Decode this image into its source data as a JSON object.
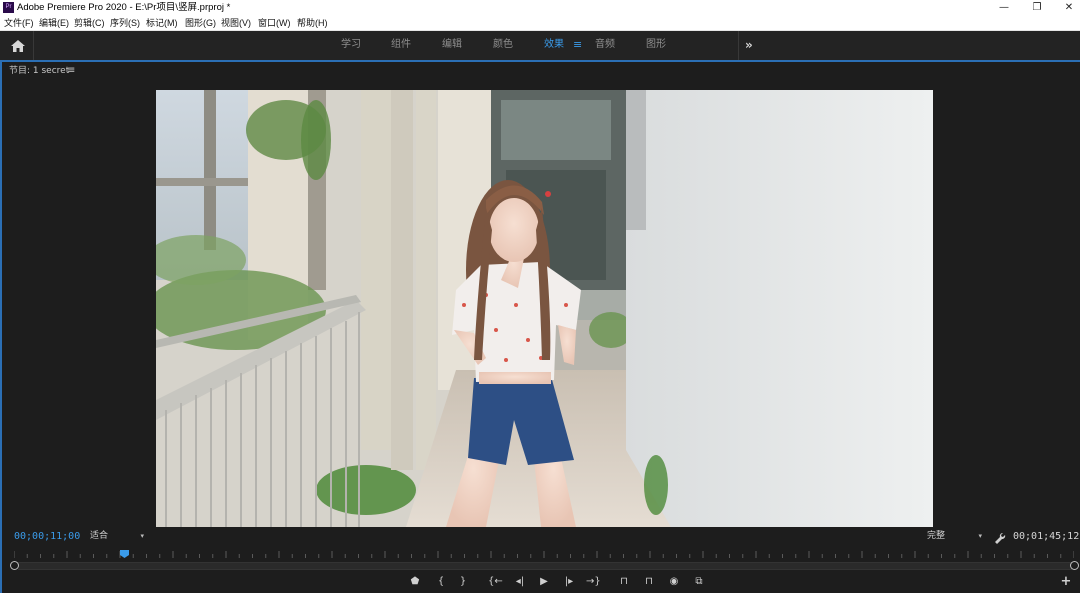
{
  "window": {
    "app_icon_text": "Pr",
    "title": "Adobe Premiere Pro 2020 - E:\\Pr项目\\竖屏.prproj *",
    "controls": [
      "—",
      "❐",
      "✕"
    ]
  },
  "menu": [
    "文件(F)",
    "编辑(E)",
    "剪辑(C)",
    "序列(S)",
    "标记(M)",
    "图形(G)",
    "视图(V)",
    "窗口(W)",
    "帮助(H)"
  ],
  "workspace": {
    "tabs": [
      "学习",
      "组件",
      "编辑",
      "颜色",
      "效果",
      "音频",
      "图形"
    ],
    "active_tab": "效果",
    "active_menu_icon": "≡",
    "more_icon": "»"
  },
  "panel": {
    "title": "节目: 1 secret",
    "menu_icon": "≡"
  },
  "monitor": {
    "current_timecode": "00;00;11;00",
    "zoom_label": "适合",
    "resolution_label": "完整",
    "duration_timecode": "00;01;45;12",
    "playhead_fraction": 0.104
  },
  "transport_controls": [
    {
      "name": "add-marker-button",
      "glyph": "⬟"
    },
    {
      "name": "mark-in-button",
      "glyph": "{"
    },
    {
      "name": "mark-out-button",
      "glyph": "}"
    },
    {
      "name": "go-to-in-button",
      "glyph": "{←"
    },
    {
      "name": "step-back-button",
      "glyph": "◂|"
    },
    {
      "name": "play-button",
      "glyph": "▶"
    },
    {
      "name": "step-forward-button",
      "glyph": "|▸"
    },
    {
      "name": "go-to-out-button",
      "glyph": "→}"
    },
    {
      "name": "lift-button",
      "glyph": "⊓"
    },
    {
      "name": "extract-button",
      "glyph": "⊓"
    },
    {
      "name": "export-frame-button",
      "glyph": "◉"
    },
    {
      "name": "comparison-view-button",
      "glyph": "⧉"
    }
  ],
  "add_button_glyph": "+",
  "colors": {
    "accent": "#3a9bea",
    "panel_bg": "#1d1d1d",
    "highlight_line": "#2b6fb5"
  }
}
